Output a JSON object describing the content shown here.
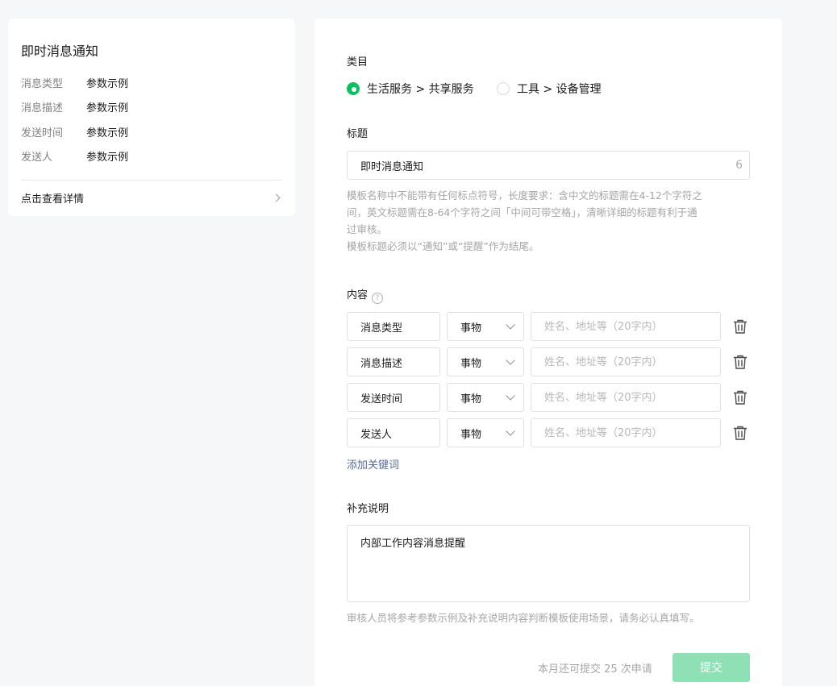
{
  "preview": {
    "title": "即时消息通知",
    "rows": [
      {
        "key": "消息类型",
        "value": "参数示例"
      },
      {
        "key": "消息描述",
        "value": "参数示例"
      },
      {
        "key": "发送时间",
        "value": "参数示例"
      },
      {
        "key": "发送人",
        "value": "参数示例"
      }
    ],
    "detail_link": "点击查看详情"
  },
  "form": {
    "category": {
      "label": "类目",
      "options": [
        {
          "label": "生活服务 > 共享服务",
          "selected": true
        },
        {
          "label": "工具 > 设备管理",
          "selected": false
        }
      ]
    },
    "title": {
      "label": "标题",
      "value": "即时消息通知",
      "count": "6",
      "hint_lines": [
        "模板名称中不能带有任何标点符号，长度要求：含中文的标题需在4-12个字符之",
        "间，英文标题需在8-64个字符之间「中间可带空格」，清晰详细的标题有利于通",
        "过审核。",
        "模板标题必须以“通知”或“提醒”作为结尾。"
      ]
    },
    "content": {
      "label": "内容",
      "help_glyph": "?",
      "rows": [
        {
          "name": "消息类型",
          "type": "事物",
          "placeholder": "姓名、地址等（20字内）"
        },
        {
          "name": "消息描述",
          "type": "事物",
          "placeholder": "姓名、地址等（20字内）"
        },
        {
          "name": "发送时间",
          "type": "事物",
          "placeholder": "姓名、地址等（20字内）"
        },
        {
          "name": "发送人",
          "type": "事物",
          "placeholder": "姓名、地址等（20字内）"
        }
      ],
      "add_keyword": "添加关键词"
    },
    "supplement": {
      "label": "补充说明",
      "value": "内部工作内容消息提醒",
      "hint": "审核人员将参考参数示例及补充说明内容判断模板使用场景，请务必认真填写。"
    },
    "footer": {
      "quota": "本月还可提交 25 次申请",
      "submit": "提交"
    }
  },
  "colors": {
    "accent": "#07c160",
    "submit_disabled": "#8fe0b4",
    "link": "#576b95",
    "page_bg": "#f6f7f9"
  },
  "icons": {
    "row_delete": "trash-icon",
    "preview_link": "chevron-right-icon",
    "select": "chevron-down-icon",
    "help": "question-circle-icon"
  }
}
